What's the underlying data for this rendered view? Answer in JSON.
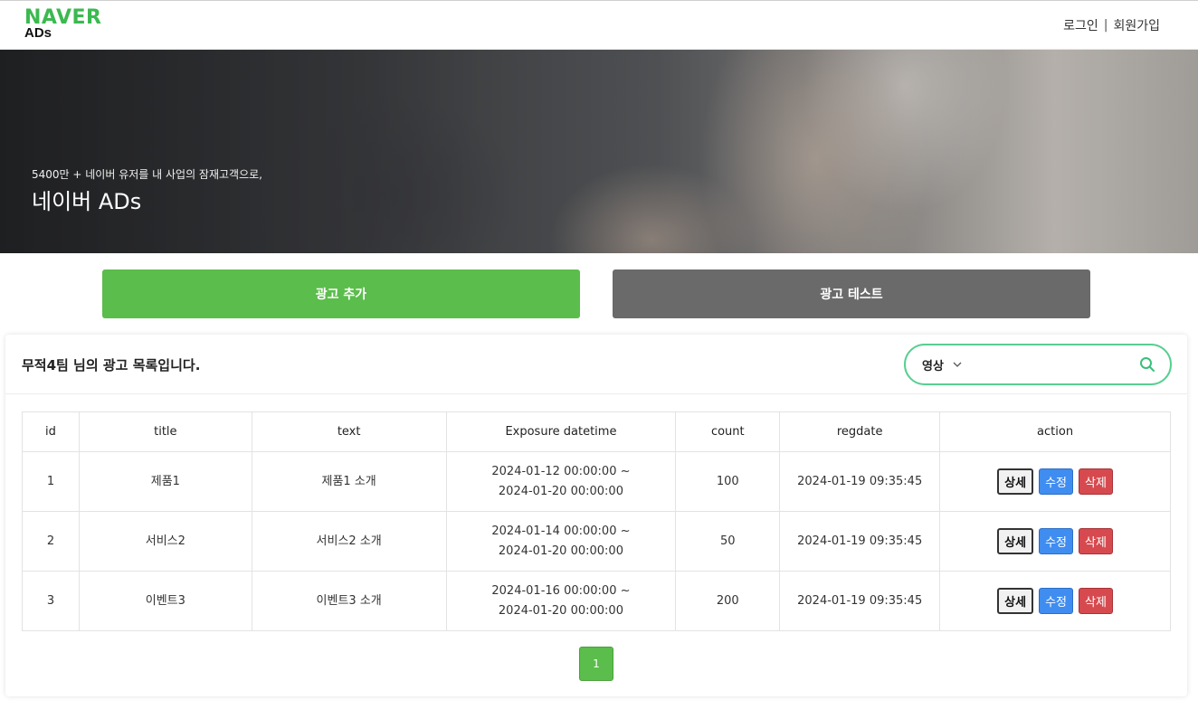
{
  "header": {
    "logo_main": "NAVER",
    "logo_sub": "ADs",
    "login": "로그인",
    "separator": "|",
    "signup": "회원가입"
  },
  "hero": {
    "subtitle": "5400만 + 네이버 유저를 내 사업의 잠재고객으로,",
    "title": "네이버 ADs"
  },
  "buttons": {
    "add": "광고 추가",
    "test": "광고 테스트"
  },
  "list": {
    "title": "무적4팀 님의 광고 목록입니다."
  },
  "search": {
    "category": "영상",
    "value": "",
    "placeholder": ""
  },
  "table": {
    "headers": [
      "id",
      "title",
      "text",
      "Exposure datetime",
      "count",
      "regdate",
      "action"
    ],
    "rows": [
      {
        "id": "1",
        "title": "제품1",
        "text": "제품1 소개",
        "exposure_start": "2024-01-12 00:00:00 ~",
        "exposure_end": "2024-01-20 00:00:00",
        "count": "100",
        "regdate": "2024-01-19 09:35:45"
      },
      {
        "id": "2",
        "title": "서비스2",
        "text": "서비스2 소개",
        "exposure_start": "2024-01-14 00:00:00 ~",
        "exposure_end": "2024-01-20 00:00:00",
        "count": "50",
        "regdate": "2024-01-19 09:35:45"
      },
      {
        "id": "3",
        "title": "이벤트3",
        "text": "이벤트3 소개",
        "exposure_start": "2024-01-16 00:00:00 ~",
        "exposure_end": "2024-01-20 00:00:00",
        "count": "200",
        "regdate": "2024-01-19 09:35:45"
      }
    ],
    "action_labels": {
      "detail": "상세",
      "edit": "수정",
      "delete": "삭제"
    }
  },
  "pagination": {
    "current": "1"
  },
  "colors": {
    "brand_green": "#5bbd4b",
    "logo_green": "#3bb94f",
    "search_border": "#57cf91",
    "test_gray": "#6a6a6a",
    "edit_blue": "#3f8df0",
    "delete_red": "#d64a4f"
  },
  "icons": {
    "search": "search-icon",
    "dropdown": "chevron-down-icon"
  }
}
